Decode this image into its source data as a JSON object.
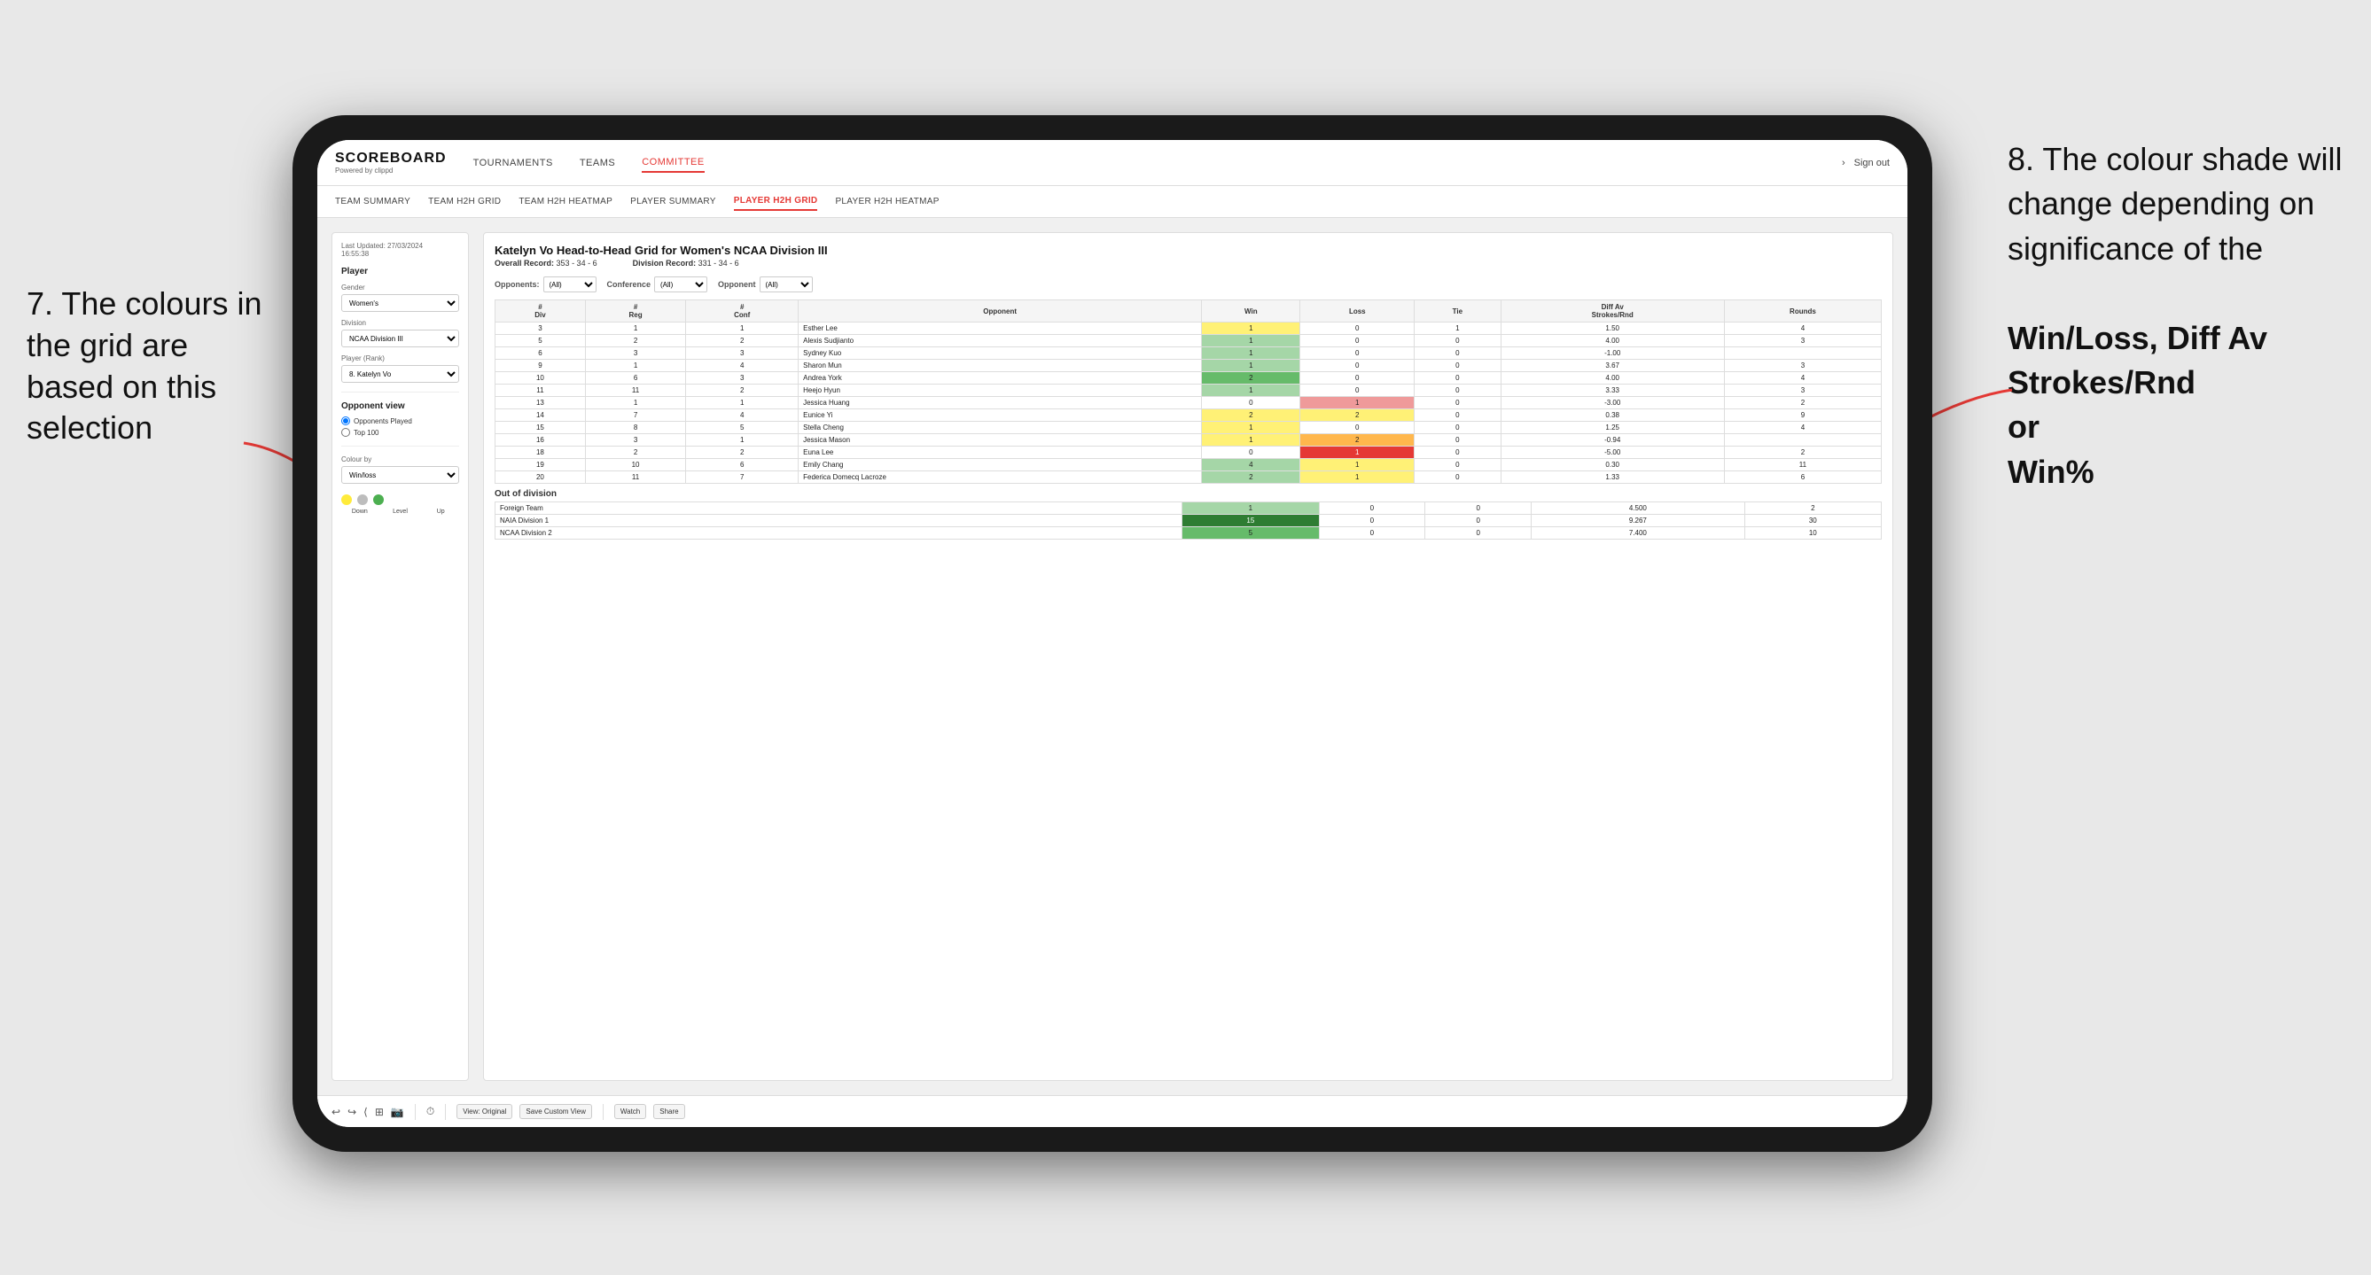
{
  "annotations": {
    "left_title": "7. The colours in the grid are based on this selection",
    "right_title": "8. The colour shade will change depending on significance of the",
    "right_bold1": "Win/Loss,",
    "right_bold2": "Diff Av Strokes/Rnd",
    "right_bold3": "or",
    "right_bold4": "Win%"
  },
  "nav": {
    "logo": "SCOREBOARD",
    "logo_sub": "Powered by clippd",
    "links": [
      "TOURNAMENTS",
      "TEAMS",
      "COMMITTEE"
    ],
    "active_link": "COMMITTEE",
    "sign_out": "Sign out"
  },
  "sub_nav": {
    "links": [
      "TEAM SUMMARY",
      "TEAM H2H GRID",
      "TEAM H2H HEATMAP",
      "PLAYER SUMMARY",
      "PLAYER H2H GRID",
      "PLAYER H2H HEATMAP"
    ],
    "active_link": "PLAYER H2H GRID"
  },
  "sidebar": {
    "timestamp_label": "Last Updated: 27/03/2024",
    "timestamp_time": "16:55:38",
    "player_section": "Player",
    "gender_label": "Gender",
    "gender_value": "Women's",
    "division_label": "Division",
    "division_value": "NCAA Division III",
    "player_rank_label": "Player (Rank)",
    "player_rank_value": "8. Katelyn Vo",
    "opponent_view_label": "Opponent view",
    "radio1": "Opponents Played",
    "radio2": "Top 100",
    "colour_by_label": "Colour by",
    "colour_by_value": "Win/loss",
    "legend_down": "Down",
    "legend_level": "Level",
    "legend_up": "Up"
  },
  "grid": {
    "title": "Katelyn Vo Head-to-Head Grid for Women's NCAA Division III",
    "overall_record_label": "Overall Record:",
    "overall_record_value": "353 - 34 - 6",
    "division_record_label": "Division Record:",
    "division_record_value": "331 - 34 - 6",
    "filter_opponents": "Opponents:",
    "filter_opponents_value": "(All)",
    "filter_conference": "Conference",
    "filter_conference_value": "(All)",
    "filter_opponent": "Opponent",
    "filter_opponent_value": "(All)",
    "col_headers": [
      "#\nDiv",
      "#\nReg",
      "#\nConf",
      "Opponent",
      "Win",
      "Loss",
      "Tie",
      "Diff Av\nStrokes/Rnd",
      "Rounds"
    ],
    "rows": [
      {
        "div": "3",
        "reg": "1",
        "conf": "1",
        "opponent": "Esther Lee",
        "win": 1,
        "loss": 0,
        "tie": 1,
        "diff": "1.50",
        "rounds": "4",
        "win_color": "yellow",
        "loss_color": "white",
        "tie_color": "white"
      },
      {
        "div": "5",
        "reg": "2",
        "conf": "2",
        "opponent": "Alexis Sudjianto",
        "win": 1,
        "loss": 0,
        "tie": 0,
        "diff": "4.00",
        "rounds": "3",
        "win_color": "green_light",
        "loss_color": "white",
        "tie_color": "white"
      },
      {
        "div": "6",
        "reg": "3",
        "conf": "3",
        "opponent": "Sydney Kuo",
        "win": 1,
        "loss": 0,
        "tie": 0,
        "diff": "-1.00",
        "rounds": "",
        "win_color": "green_light",
        "loss_color": "white",
        "tie_color": "white"
      },
      {
        "div": "9",
        "reg": "1",
        "conf": "4",
        "opponent": "Sharon Mun",
        "win": 1,
        "loss": 0,
        "tie": 0,
        "diff": "3.67",
        "rounds": "3",
        "win_color": "green_light",
        "loss_color": "white",
        "tie_color": "white"
      },
      {
        "div": "10",
        "reg": "6",
        "conf": "3",
        "opponent": "Andrea York",
        "win": 2,
        "loss": 0,
        "tie": 0,
        "diff": "4.00",
        "rounds": "4",
        "win_color": "green_med",
        "loss_color": "white",
        "tie_color": "white"
      },
      {
        "div": "11",
        "reg": "11",
        "conf": "2",
        "opponent": "Heejo Hyun",
        "win": 1,
        "loss": 0,
        "tie": 0,
        "diff": "3.33",
        "rounds": "3",
        "win_color": "green_light",
        "loss_color": "white",
        "tie_color": "white"
      },
      {
        "div": "13",
        "reg": "1",
        "conf": "1",
        "opponent": "Jessica Huang",
        "win": 0,
        "loss": 1,
        "tie": 0,
        "diff": "-3.00",
        "rounds": "2",
        "win_color": "white",
        "loss_color": "red_light",
        "tie_color": "white"
      },
      {
        "div": "14",
        "reg": "7",
        "conf": "4",
        "opponent": "Eunice Yi",
        "win": 2,
        "loss": 2,
        "tie": 0,
        "diff": "0.38",
        "rounds": "9",
        "win_color": "yellow",
        "loss_color": "yellow",
        "tie_color": "white"
      },
      {
        "div": "15",
        "reg": "8",
        "conf": "5",
        "opponent": "Stella Cheng",
        "win": 1,
        "loss": 0,
        "tie": 0,
        "diff": "1.25",
        "rounds": "4",
        "win_color": "yellow",
        "loss_color": "white",
        "tie_color": "white"
      },
      {
        "div": "16",
        "reg": "3",
        "conf": "1",
        "opponent": "Jessica Mason",
        "win": 1,
        "loss": 2,
        "tie": 0,
        "diff": "-0.94",
        "rounds": "",
        "win_color": "yellow",
        "loss_color": "orange",
        "tie_color": "white"
      },
      {
        "div": "18",
        "reg": "2",
        "conf": "2",
        "opponent": "Euna Lee",
        "win": 0,
        "loss": 1,
        "tie": 0,
        "diff": "-5.00",
        "rounds": "2",
        "win_color": "white",
        "loss_color": "red",
        "tie_color": "white"
      },
      {
        "div": "19",
        "reg": "10",
        "conf": "6",
        "opponent": "Emily Chang",
        "win": 4,
        "loss": 1,
        "tie": 0,
        "diff": "0.30",
        "rounds": "11",
        "win_color": "green_light",
        "loss_color": "yellow",
        "tie_color": "white"
      },
      {
        "div": "20",
        "reg": "11",
        "conf": "7",
        "opponent": "Federica Domecq Lacroze",
        "win": 2,
        "loss": 1,
        "tie": 0,
        "diff": "1.33",
        "rounds": "6",
        "win_color": "green_light",
        "loss_color": "yellow",
        "tie_color": "white"
      }
    ],
    "out_of_division_label": "Out of division",
    "out_of_division_rows": [
      {
        "opponent": "Foreign Team",
        "win": 1,
        "loss": 0,
        "tie": 0,
        "diff": "4.500",
        "rounds": "2",
        "win_color": "green_light"
      },
      {
        "opponent": "NAIA Division 1",
        "win": 15,
        "loss": 0,
        "tie": 0,
        "diff": "9.267",
        "rounds": "30",
        "win_color": "green_dark"
      },
      {
        "opponent": "NCAA Division 2",
        "win": 5,
        "loss": 0,
        "tie": 0,
        "diff": "7.400",
        "rounds": "10",
        "win_color": "green_med"
      }
    ]
  },
  "toolbar": {
    "view_original": "View: Original",
    "save_custom": "Save Custom View",
    "watch": "Watch",
    "share": "Share"
  }
}
